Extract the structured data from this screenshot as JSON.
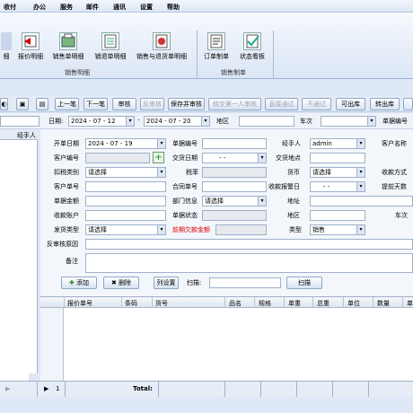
{
  "menu": [
    "收付",
    "办公",
    "服务",
    "邮件",
    "通讯",
    "设置",
    "帮助"
  ],
  "ribbon": {
    "buttons": [
      "报价明细",
      "销售单明细",
      "销退单明细",
      "销售与退货单明细",
      "订单制单",
      "状态看板"
    ],
    "first_partial": "细",
    "group1": "销售明细",
    "group2": "销售制单"
  },
  "toolbar": {
    "buttons": [
      "上一笔",
      "下一笔",
      "审核",
      "反审核",
      "保存并审核",
      "转交第一人审核",
      "直接通过",
      "不通过",
      "可出库",
      "转出库"
    ]
  },
  "filter": {
    "date_label": "日期:",
    "date_from": "2024 - 07 - 12",
    "date_to": "2024 - 07 - 20",
    "region_label": "地区",
    "train_label": "车次",
    "order_no_label": "单据编号"
  },
  "left_header": "经手人",
  "form": {
    "start_date_label": "开单日期",
    "start_date": "2024 - 07 - 19",
    "doc_no_label": "单据编号",
    "handler_label": "经手人",
    "handler_value": "admin",
    "customer_name_label": "客户名称",
    "customer_no_label": "客户编号",
    "deal_date_label": "交货日期",
    "deal_date_value": "- -",
    "deal_place_label": "交货地点",
    "deduct_label": "扣税类别",
    "deduct_value": "请选择",
    "tax_rate_label": "税率",
    "currency_label": "货币",
    "currency_value": "请选择",
    "pay_method_label": "收款方式",
    "cust_doc_label": "客户单号",
    "contract_label": "合同单号",
    "receipt_date_label": "收款报警日",
    "receipt_date_value": "- -",
    "advance_days_label": "提前天数",
    "amount_label": "单据金额",
    "dept_label": "部门信息",
    "dept_value": "请选择",
    "address_label": "地址",
    "account_label": "收款账户",
    "status_label": "单据状态",
    "region_label": "地区",
    "train_label": "车次",
    "ship_label": "发货类型",
    "ship_value": "请选择",
    "overdue_label": "前期欠款金额",
    "type_label": "类型",
    "type_value": "销售",
    "reject_label": "反审核原因",
    "remark_label": "备注",
    "add_btn": "添加",
    "delete_btn": "删除",
    "colset_btn": "列设置",
    "scan_label": "扫描:",
    "scan_btn": "扫描"
  },
  "grid": {
    "headers": [
      "报价单号",
      "条码",
      "货号",
      "品名",
      "规格",
      "单重",
      "总重",
      "单位",
      "数量",
      "单"
    ]
  },
  "bottom": {
    "row_no": "1",
    "total_label": "Total:"
  }
}
